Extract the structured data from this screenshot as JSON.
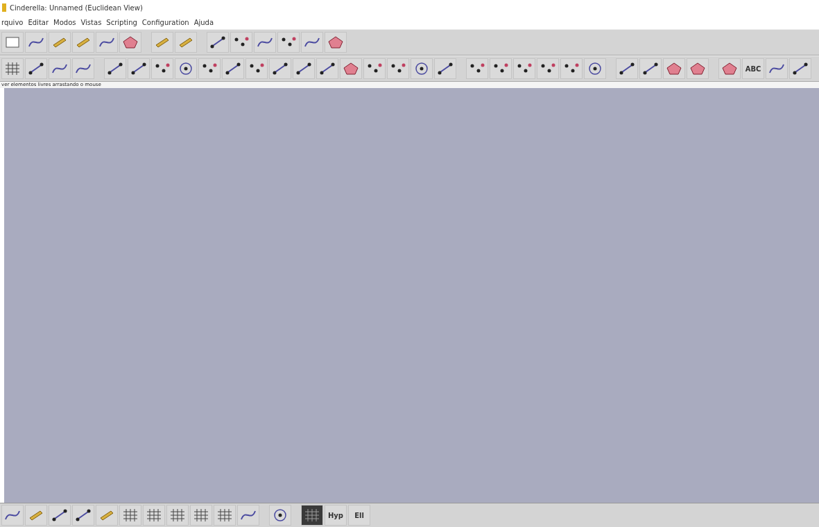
{
  "window": {
    "title": "Cinderella: Unnamed (Euclidean View)"
  },
  "menu": [
    "rquivo",
    "Editar",
    "Modos",
    "Vistas",
    "Scripting",
    "Configuration",
    "Ajuda"
  ],
  "toolbar_modes": {
    "text_tool": "ABC"
  },
  "status_bar": {
    "text": "ver elementos livres arrastando o mouse"
  },
  "geometry_bar": {
    "labels": [
      "Hyp",
      "Ell"
    ]
  }
}
